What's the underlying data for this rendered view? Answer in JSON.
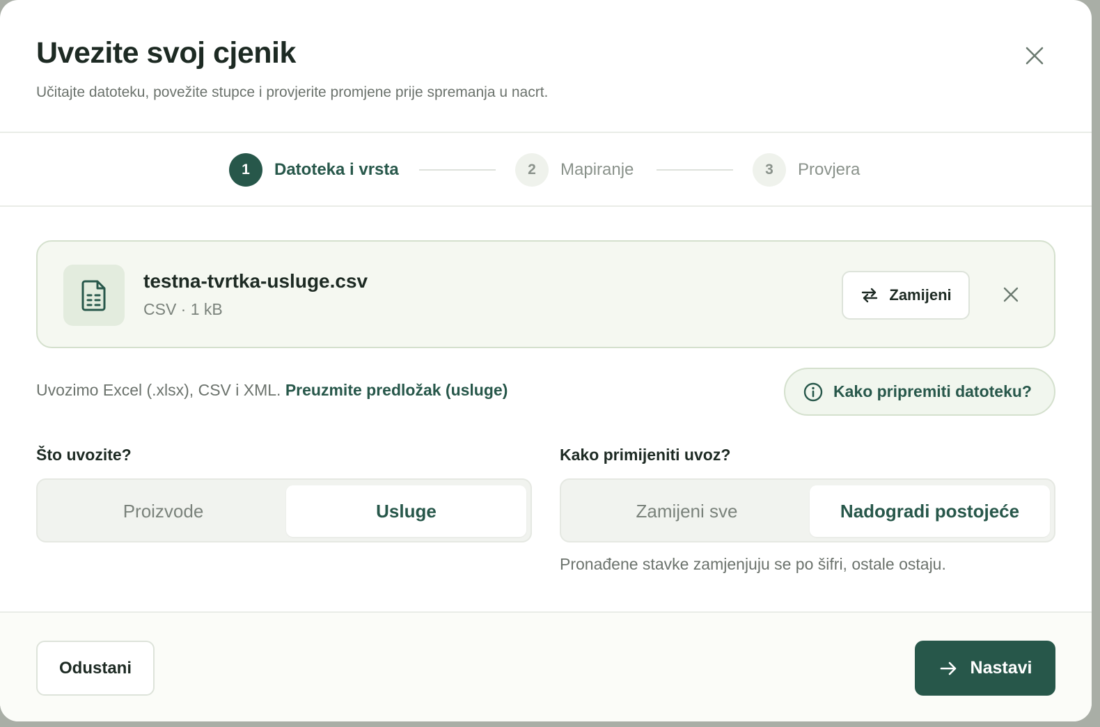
{
  "dialog": {
    "title": "Uvezite svoj cjenik",
    "subtitle": "Učitajte datoteku, povežite stupce i provjerite promjene prije spremanja u nacrt."
  },
  "stepper": {
    "steps": [
      {
        "number": "1",
        "label": "Datoteka i vrsta",
        "state": "active"
      },
      {
        "number": "2",
        "label": "Mapiranje",
        "state": "upcoming"
      },
      {
        "number": "3",
        "label": "Provjera",
        "state": "upcoming"
      }
    ]
  },
  "file": {
    "name": "testna-tvrtka-usluge.csv",
    "meta": "CSV · 1 kB",
    "replace_label": "Zamijeni"
  },
  "formats": {
    "text": "Uvozimo Excel (.xlsx), CSV i XML.",
    "template_link": "Preuzmite predložak (usluge)"
  },
  "help": {
    "label": "Kako pripremiti datoteku?"
  },
  "import_type": {
    "question": "Što uvozite?",
    "options": [
      "Proizvode",
      "Usluge"
    ],
    "selected": "Usluge"
  },
  "apply_mode": {
    "question": "Kako primijeniti uvoz?",
    "options": [
      "Zamijeni sve",
      "Nadogradi postojeće"
    ],
    "selected": "Nadogradi postojeće",
    "hint": "Pronađene stavke zamjenjuju se po šifri, ostale ostaju."
  },
  "footer": {
    "cancel_label": "Odustani",
    "next_label": "Nastavi"
  },
  "colors": {
    "accent": "#27574a",
    "card_bg": "#f5f8f1",
    "card_border": "#d4e0cd"
  }
}
